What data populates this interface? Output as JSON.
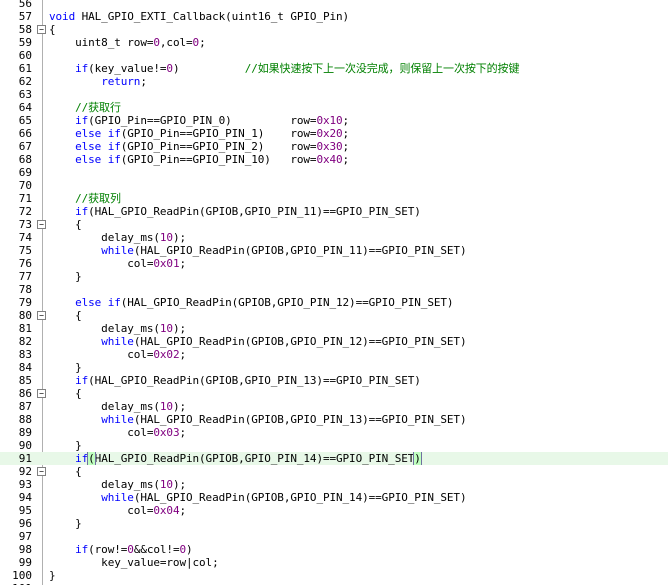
{
  "editor": {
    "lines": [
      {
        "n": "56",
        "fold": "",
        "tokens": []
      },
      {
        "n": "57",
        "fold": "",
        "tokens": [
          {
            "c": "kw",
            "t": "void"
          },
          {
            "c": "",
            "t": " HAL_GPIO_EXTI_Callback(uint16_t GPIO_Pin)"
          }
        ]
      },
      {
        "n": "58",
        "fold": "−",
        "tokens": [
          {
            "c": "",
            "t": "{"
          }
        ]
      },
      {
        "n": "59",
        "fold": "",
        "tokens": [
          {
            "c": "",
            "t": "    uint8_t row="
          },
          {
            "c": "num",
            "t": "0"
          },
          {
            "c": "",
            "t": ",col="
          },
          {
            "c": "num",
            "t": "0"
          },
          {
            "c": "",
            "t": ";"
          }
        ]
      },
      {
        "n": "60",
        "fold": "",
        "tokens": []
      },
      {
        "n": "61",
        "fold": "",
        "tokens": [
          {
            "c": "",
            "t": "    "
          },
          {
            "c": "kw",
            "t": "if"
          },
          {
            "c": "",
            "t": "(key_value!="
          },
          {
            "c": "num",
            "t": "0"
          },
          {
            "c": "",
            "t": ")          "
          },
          {
            "c": "cm",
            "t": "//如果快速按下上一次没完成，则保留上一次按下的按键"
          }
        ]
      },
      {
        "n": "62",
        "fold": "",
        "tokens": [
          {
            "c": "",
            "t": "        "
          },
          {
            "c": "kw",
            "t": "return"
          },
          {
            "c": "",
            "t": ";"
          }
        ]
      },
      {
        "n": "63",
        "fold": "",
        "tokens": []
      },
      {
        "n": "64",
        "fold": "",
        "tokens": [
          {
            "c": "",
            "t": "    "
          },
          {
            "c": "cm",
            "t": "//获取行"
          }
        ]
      },
      {
        "n": "65",
        "fold": "",
        "tokens": [
          {
            "c": "",
            "t": "    "
          },
          {
            "c": "kw",
            "t": "if"
          },
          {
            "c": "",
            "t": "(GPIO_Pin==GPIO_PIN_0)         row="
          },
          {
            "c": "num",
            "t": "0x10"
          },
          {
            "c": "",
            "t": ";"
          }
        ]
      },
      {
        "n": "66",
        "fold": "",
        "tokens": [
          {
            "c": "",
            "t": "    "
          },
          {
            "c": "kw",
            "t": "else if"
          },
          {
            "c": "",
            "t": "(GPIO_Pin==GPIO_PIN_1)    row="
          },
          {
            "c": "num",
            "t": "0x20"
          },
          {
            "c": "",
            "t": ";"
          }
        ]
      },
      {
        "n": "67",
        "fold": "",
        "tokens": [
          {
            "c": "",
            "t": "    "
          },
          {
            "c": "kw",
            "t": "else if"
          },
          {
            "c": "",
            "t": "(GPIO_Pin==GPIO_PIN_2)    row="
          },
          {
            "c": "num",
            "t": "0x30"
          },
          {
            "c": "",
            "t": ";"
          }
        ]
      },
      {
        "n": "68",
        "fold": "",
        "tokens": [
          {
            "c": "",
            "t": "    "
          },
          {
            "c": "kw",
            "t": "else if"
          },
          {
            "c": "",
            "t": "(GPIO_Pin==GPIO_PIN_10)   row="
          },
          {
            "c": "num",
            "t": "0x40"
          },
          {
            "c": "",
            "t": ";"
          }
        ]
      },
      {
        "n": "69",
        "fold": "",
        "tokens": []
      },
      {
        "n": "70",
        "fold": "",
        "tokens": []
      },
      {
        "n": "71",
        "fold": "",
        "tokens": [
          {
            "c": "",
            "t": "    "
          },
          {
            "c": "cm",
            "t": "//获取列"
          }
        ]
      },
      {
        "n": "72",
        "fold": "",
        "tokens": [
          {
            "c": "",
            "t": "    "
          },
          {
            "c": "kw",
            "t": "if"
          },
          {
            "c": "",
            "t": "(HAL_GPIO_ReadPin(GPIOB,GPIO_PIN_11)==GPIO_PIN_SET)"
          }
        ]
      },
      {
        "n": "73",
        "fold": "−",
        "tokens": [
          {
            "c": "",
            "t": "    {"
          }
        ]
      },
      {
        "n": "74",
        "fold": "",
        "tokens": [
          {
            "c": "",
            "t": "        delay_ms("
          },
          {
            "c": "num",
            "t": "10"
          },
          {
            "c": "",
            "t": ");"
          }
        ]
      },
      {
        "n": "75",
        "fold": "",
        "tokens": [
          {
            "c": "",
            "t": "        "
          },
          {
            "c": "kw",
            "t": "while"
          },
          {
            "c": "",
            "t": "(HAL_GPIO_ReadPin(GPIOB,GPIO_PIN_11)==GPIO_PIN_SET)"
          }
        ]
      },
      {
        "n": "76",
        "fold": "",
        "tokens": [
          {
            "c": "",
            "t": "            col="
          },
          {
            "c": "num",
            "t": "0x01"
          },
          {
            "c": "",
            "t": ";"
          }
        ]
      },
      {
        "n": "77",
        "fold": "",
        "tokens": [
          {
            "c": "",
            "t": "    }"
          }
        ]
      },
      {
        "n": "78",
        "fold": "",
        "tokens": []
      },
      {
        "n": "79",
        "fold": "",
        "tokens": [
          {
            "c": "",
            "t": "    "
          },
          {
            "c": "kw",
            "t": "else if"
          },
          {
            "c": "",
            "t": "(HAL_GPIO_ReadPin(GPIOB,GPIO_PIN_12)==GPIO_PIN_SET)"
          }
        ]
      },
      {
        "n": "80",
        "fold": "−",
        "tokens": [
          {
            "c": "",
            "t": "    {"
          }
        ]
      },
      {
        "n": "81",
        "fold": "",
        "tokens": [
          {
            "c": "",
            "t": "        delay_ms("
          },
          {
            "c": "num",
            "t": "10"
          },
          {
            "c": "",
            "t": ");"
          }
        ]
      },
      {
        "n": "82",
        "fold": "",
        "tokens": [
          {
            "c": "",
            "t": "        "
          },
          {
            "c": "kw",
            "t": "while"
          },
          {
            "c": "",
            "t": "(HAL_GPIO_ReadPin(GPIOB,GPIO_PIN_12)==GPIO_PIN_SET)"
          }
        ]
      },
      {
        "n": "83",
        "fold": "",
        "tokens": [
          {
            "c": "",
            "t": "            col="
          },
          {
            "c": "num",
            "t": "0x02"
          },
          {
            "c": "",
            "t": ";"
          }
        ]
      },
      {
        "n": "84",
        "fold": "",
        "tokens": [
          {
            "c": "",
            "t": "    }"
          }
        ]
      },
      {
        "n": "85",
        "fold": "",
        "tokens": [
          {
            "c": "",
            "t": "    "
          },
          {
            "c": "kw",
            "t": "if"
          },
          {
            "c": "",
            "t": "(HAL_GPIO_ReadPin(GPIOB,GPIO_PIN_13)==GPIO_PIN_SET)"
          }
        ]
      },
      {
        "n": "86",
        "fold": "−",
        "tokens": [
          {
            "c": "",
            "t": "    {"
          }
        ]
      },
      {
        "n": "87",
        "fold": "",
        "tokens": [
          {
            "c": "",
            "t": "        delay_ms("
          },
          {
            "c": "num",
            "t": "10"
          },
          {
            "c": "",
            "t": ");"
          }
        ]
      },
      {
        "n": "88",
        "fold": "",
        "tokens": [
          {
            "c": "",
            "t": "        "
          },
          {
            "c": "kw",
            "t": "while"
          },
          {
            "c": "",
            "t": "(HAL_GPIO_ReadPin(GPIOB,GPIO_PIN_13)==GPIO_PIN_SET)"
          }
        ]
      },
      {
        "n": "89",
        "fold": "",
        "tokens": [
          {
            "c": "",
            "t": "            col="
          },
          {
            "c": "num",
            "t": "0x03"
          },
          {
            "c": "",
            "t": ";"
          }
        ]
      },
      {
        "n": "90",
        "fold": "",
        "tokens": [
          {
            "c": "",
            "t": "    }"
          }
        ]
      },
      {
        "n": "91",
        "fold": "",
        "current": true,
        "tokens": [
          {
            "c": "",
            "t": "    "
          },
          {
            "c": "kw",
            "t": "if"
          },
          {
            "c": "bm",
            "t": "("
          },
          {
            "c": "",
            "t": "HAL_GPIO_ReadPin(GPIOB,GPIO_PIN_14)==GPIO_PIN_SET"
          },
          {
            "c": "bm",
            "t": ")"
          }
        ]
      },
      {
        "n": "92",
        "fold": "−",
        "tokens": [
          {
            "c": "",
            "t": "    {"
          }
        ]
      },
      {
        "n": "93",
        "fold": "",
        "tokens": [
          {
            "c": "",
            "t": "        delay_ms("
          },
          {
            "c": "num",
            "t": "10"
          },
          {
            "c": "",
            "t": ");"
          }
        ]
      },
      {
        "n": "94",
        "fold": "",
        "tokens": [
          {
            "c": "",
            "t": "        "
          },
          {
            "c": "kw",
            "t": "while"
          },
          {
            "c": "",
            "t": "(HAL_GPIO_ReadPin(GPIOB,GPIO_PIN_14)==GPIO_PIN_SET)"
          }
        ]
      },
      {
        "n": "95",
        "fold": "",
        "tokens": [
          {
            "c": "",
            "t": "            col="
          },
          {
            "c": "num",
            "t": "0x04"
          },
          {
            "c": "",
            "t": ";"
          }
        ]
      },
      {
        "n": "96",
        "fold": "",
        "tokens": [
          {
            "c": "",
            "t": "    }"
          }
        ]
      },
      {
        "n": "97",
        "fold": "",
        "tokens": []
      },
      {
        "n": "98",
        "fold": "",
        "tokens": [
          {
            "c": "",
            "t": "    "
          },
          {
            "c": "kw",
            "t": "if"
          },
          {
            "c": "",
            "t": "(row!="
          },
          {
            "c": "num",
            "t": "0"
          },
          {
            "c": "",
            "t": "&&col!="
          },
          {
            "c": "num",
            "t": "0"
          },
          {
            "c": "",
            "t": ")"
          }
        ]
      },
      {
        "n": "99",
        "fold": "",
        "tokens": [
          {
            "c": "",
            "t": "        key_value=row|col;"
          }
        ]
      },
      {
        "n": "100",
        "fold": "",
        "tokens": [
          {
            "c": "",
            "t": "}"
          }
        ]
      },
      {
        "n": "101",
        "fold": "",
        "tokens": []
      }
    ]
  },
  "colors": {
    "keyword": "#0000ff",
    "number": "#800080",
    "comment": "#008000",
    "current_line": "#e8f8e8"
  }
}
